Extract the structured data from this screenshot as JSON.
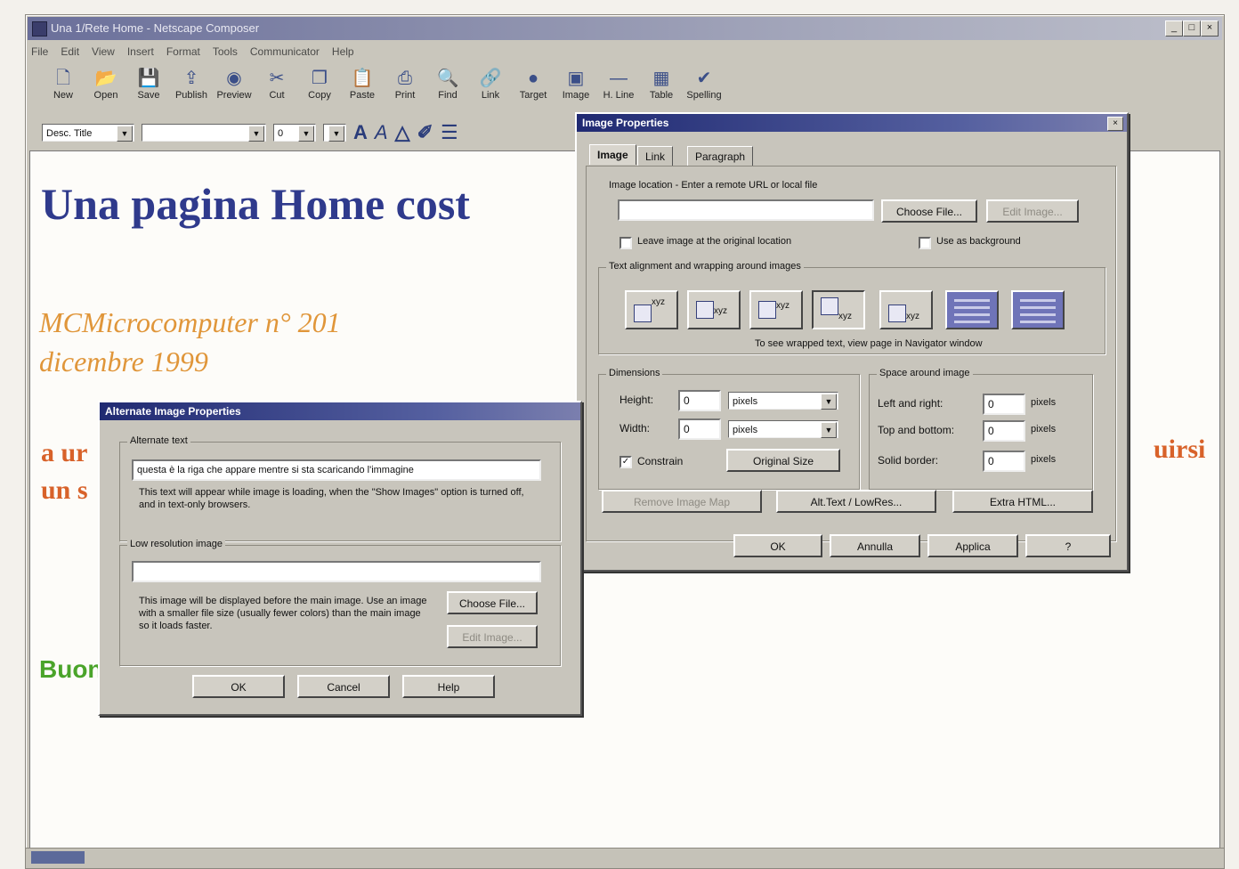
{
  "window": {
    "title": "Una 1/Rete Home - Netscape Composer",
    "controls": [
      "_",
      "□",
      "×"
    ]
  },
  "menu": [
    "File",
    "Edit",
    "View",
    "Insert",
    "Format",
    "Tools",
    "Communicator",
    "Help"
  ],
  "toolbar": [
    {
      "label": "New",
      "icon": "new-doc-icon",
      "glyph": "🗋"
    },
    {
      "label": "Open",
      "icon": "open-icon",
      "glyph": "📂"
    },
    {
      "label": "Save",
      "icon": "save-icon",
      "glyph": "💾"
    },
    {
      "label": "Publish",
      "icon": "publish-icon",
      "glyph": "⇪"
    },
    {
      "label": "Preview",
      "icon": "preview-icon",
      "glyph": "◉"
    },
    {
      "label": "Cut",
      "icon": "cut-icon",
      "glyph": "✂"
    },
    {
      "label": "Copy",
      "icon": "copy-icon",
      "glyph": "❐"
    },
    {
      "label": "Paste",
      "icon": "paste-icon",
      "glyph": "📋"
    },
    {
      "label": "Print",
      "icon": "print-icon",
      "glyph": "⎙"
    },
    {
      "label": "Find",
      "icon": "find-icon",
      "glyph": "🔍"
    },
    {
      "label": "Link",
      "icon": "link-icon",
      "glyph": "🔗"
    },
    {
      "label": "Target",
      "icon": "target-icon",
      "glyph": "●"
    },
    {
      "label": "Image",
      "icon": "image-icon",
      "glyph": "▣"
    },
    {
      "label": "H. Line",
      "icon": "hline-icon",
      "glyph": "—"
    },
    {
      "label": "Table",
      "icon": "table-icon",
      "glyph": "▦"
    },
    {
      "label": "Spelling",
      "icon": "spelling-icon",
      "glyph": "✔"
    }
  ],
  "format": {
    "style": "Desc. Title",
    "font": "",
    "size": "0"
  },
  "doc": {
    "heading": "Una pagina Home cost",
    "subtitle_line1": "MCMicrocomputer n° 201",
    "subtitle_line2": "dicembre 1999",
    "orange_left1": "a ur",
    "orange_left2": "un s",
    "orange_right": "uirsi",
    "green": "Buon"
  },
  "colors": {
    "heading": "#2f3a8c",
    "subtitle": "#e0963a",
    "orange_text": "#d8622a",
    "green_text": "#4aa42a"
  },
  "imageDialog": {
    "title": "Image Properties",
    "tabs": [
      "Image",
      "Link",
      "Paragraph"
    ],
    "location_label": "Image location - Enter a remote URL or local file",
    "location_value": "",
    "choose_file": "Choose File...",
    "edit_image": "Edit Image...",
    "leave_original": "Leave image at the original location",
    "use_background": "Use as background",
    "wrap_label": "Text alignment and wrapping around images",
    "wrap_note": "To see wrapped text, view page in Navigator window",
    "wrap_glyph": "xyz",
    "dimensions_label": "Dimensions",
    "height_label": "Height:",
    "height_value": "0",
    "height_unit": "pixels",
    "width_label": "Width:",
    "width_value": "0",
    "width_unit": "pixels",
    "constrain": "Constrain",
    "original_size": "Original Size",
    "space_label": "Space around image",
    "left_right": "Left and right:",
    "left_right_value": "0",
    "top_bottom": "Top and bottom:",
    "top_bottom_value": "0",
    "solid_border": "Solid border:",
    "solid_border_value": "0",
    "pixels": "pixels",
    "remove_imagemap": "Remove Image Map",
    "alt_text": "Alt.Text / LowRes...",
    "extra_html": "Extra HTML...",
    "ok": "OK",
    "annulla": "Annulla",
    "applica": "Applica",
    "help": "?"
  },
  "altDialog": {
    "title": "Alternate Image Properties",
    "alt_label": "Alternate text",
    "alt_value": "questa è la riga che appare mentre si sta scaricando l'immagine",
    "alt_help": "This text will appear while image is loading, when the \"Show Images\" option is turned off, and in text-only browsers.",
    "lowres_label": "Low resolution image",
    "lowres_value": "",
    "lowres_help": "This image will be displayed before the main image. Use an image with a smaller file size (usually fewer colors) than the main image so it loads faster.",
    "choose_file": "Choose File...",
    "edit_image": "Edit Image...",
    "ok": "OK",
    "cancel": "Cancel",
    "help": "Help"
  }
}
